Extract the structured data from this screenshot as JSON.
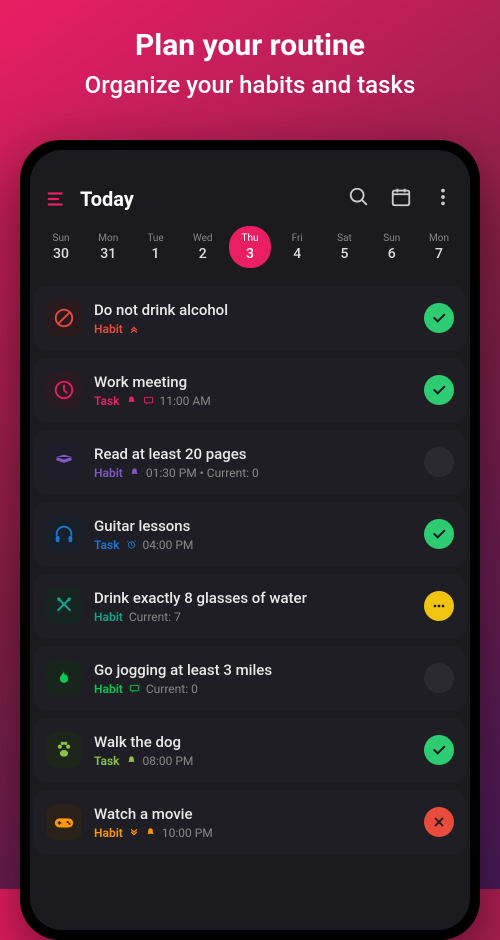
{
  "marketing": {
    "title": "Plan your routine",
    "subtitle": "Organize your habits and tasks"
  },
  "header": {
    "title": "Today"
  },
  "week": [
    {
      "dow": "Sun",
      "num": "30",
      "selected": false
    },
    {
      "dow": "Mon",
      "num": "31",
      "selected": false
    },
    {
      "dow": "Tue",
      "num": "1",
      "selected": false
    },
    {
      "dow": "Wed",
      "num": "2",
      "selected": false
    },
    {
      "dow": "Thu",
      "num": "3",
      "selected": true
    },
    {
      "dow": "Fri",
      "num": "4",
      "selected": false
    },
    {
      "dow": "Sat",
      "num": "5",
      "selected": false
    },
    {
      "dow": "Sun",
      "num": "6",
      "selected": false
    },
    {
      "dow": "Mon",
      "num": "7",
      "selected": false
    }
  ],
  "colors": {
    "red": "#e74c3c",
    "green": "#2ecc71",
    "purple": "#9b59b6",
    "darkblue": "#1976d2",
    "teal": "#16a085",
    "yellow": "#f1c40f",
    "orange": "#ff9800",
    "pink": "#e91e63",
    "greenbright": "#00c853"
  },
  "items": [
    {
      "icon": "prohibit",
      "iconColor": "#e74c3c",
      "iconBg": "#2a1a1d",
      "title": "Do not drink alcohol",
      "type": "Habit",
      "typeColor": "#e74c3c",
      "indicators": [
        "priority"
      ],
      "detail": "",
      "status": "check",
      "statusColor": "#2ecc71"
    },
    {
      "icon": "clock",
      "iconColor": "#e91e63",
      "iconBg": "#2a1a22",
      "title": "Work meeting",
      "type": "Task",
      "typeColor": "#e91e63",
      "indicators": [
        "bell",
        "message"
      ],
      "detail": "11:00 AM",
      "status": "check",
      "statusColor": "#2ecc71"
    },
    {
      "icon": "book",
      "iconColor": "#7e57c2",
      "iconBg": "#201d2a",
      "title": "Read at least 20 pages",
      "type": "Habit",
      "typeColor": "#7e57c2",
      "indicators": [
        "bell"
      ],
      "detail": "01:30 PM • Current: 0",
      "status": "empty",
      "statusColor": "#333"
    },
    {
      "icon": "headphones",
      "iconColor": "#1976d2",
      "iconBg": "#18202a",
      "title": "Guitar lessons",
      "type": "Task",
      "typeColor": "#1976d2",
      "indicators": [
        "alarm"
      ],
      "detail": "04:00 PM",
      "status": "check",
      "statusColor": "#2ecc71"
    },
    {
      "icon": "utensils",
      "iconColor": "#16a085",
      "iconBg": "#172522",
      "title": "Drink exactly 8 glasses of water",
      "type": "Habit",
      "typeColor": "#16a085",
      "indicators": [],
      "detail": "Current: 7",
      "status": "dots",
      "statusColor": "#f1c40f"
    },
    {
      "icon": "fire",
      "iconColor": "#00c853",
      "iconBg": "#17251c",
      "title": "Go jogging at least 3 miles",
      "type": "Habit",
      "typeColor": "#00c853",
      "indicators": [
        "message"
      ],
      "detail": "Current: 0",
      "status": "empty",
      "statusColor": "#333"
    },
    {
      "icon": "paw",
      "iconColor": "#8bc34a",
      "iconBg": "#1e251a",
      "title": "Walk the dog",
      "type": "Task",
      "typeColor": "#8bc34a",
      "indicators": [
        "bell"
      ],
      "detail": "08:00 PM",
      "status": "check",
      "statusColor": "#2ecc71"
    },
    {
      "icon": "gamepad",
      "iconColor": "#ff9800",
      "iconBg": "#2a2218",
      "title": "Watch a movie",
      "type": "Habit",
      "typeColor": "#ff9800",
      "indicators": [
        "priority-down",
        "bell"
      ],
      "detail": "10:00 PM",
      "status": "close",
      "statusColor": "#e74c3c"
    }
  ]
}
